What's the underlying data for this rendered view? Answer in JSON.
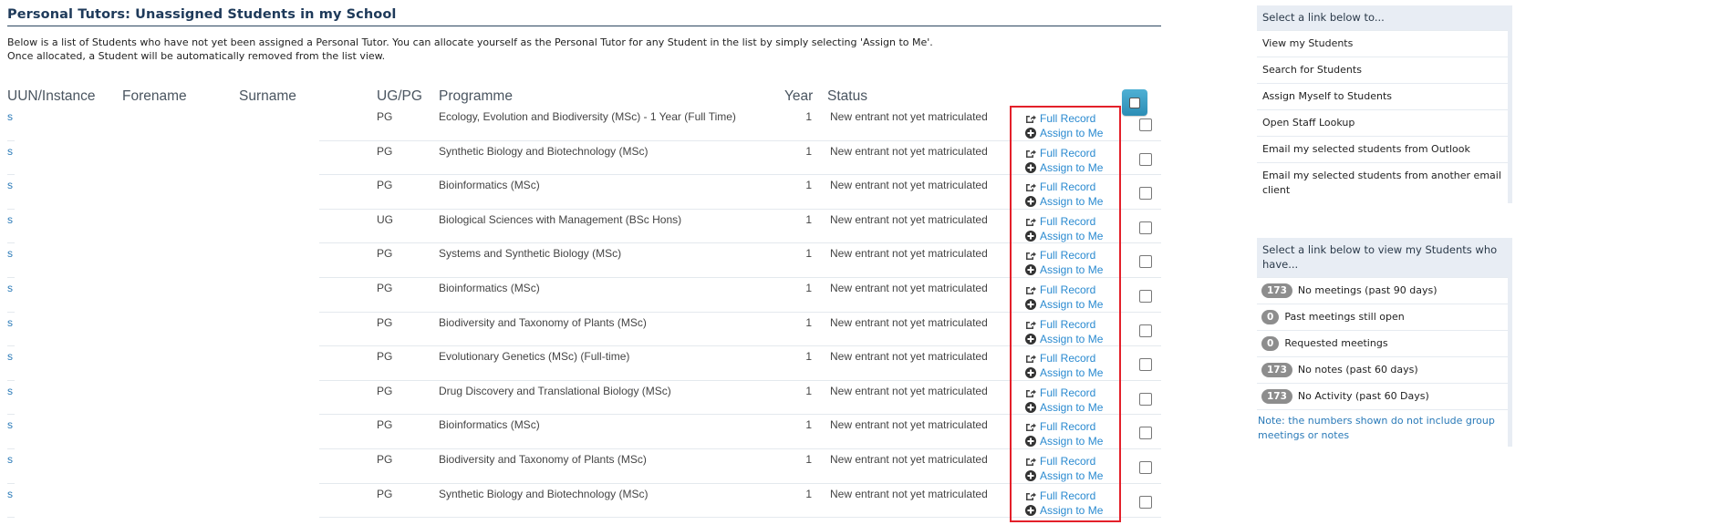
{
  "page": {
    "title": "Personal Tutors: Unassigned Students in my School",
    "intro_line1": "Below is a list of Students who have not yet been assigned a Personal Tutor. You can allocate yourself as the Personal Tutor for any Student in the list by simply selecting 'Assign to Me'.",
    "intro_line2": "Once allocated, a Student will be automatically removed from the list view."
  },
  "table": {
    "headers": {
      "uun": "UUN/Instance",
      "forename": "Forename",
      "surname": "Surname",
      "ugpg": "UG/PG",
      "programme": "Programme",
      "year": "Year",
      "status": "Status"
    },
    "actions": {
      "full_record": "Full Record",
      "assign": "Assign to Me"
    },
    "rows": [
      {
        "uun": "s",
        "ugpg": "PG",
        "programme": "Ecology, Evolution and Biodiversity (MSc) - 1 Year (Full Time)",
        "year": "1",
        "status": "New entrant not yet matriculated"
      },
      {
        "uun": "s",
        "ugpg": "PG",
        "programme": "Synthetic Biology and Biotechnology (MSc)",
        "year": "1",
        "status": "New entrant not yet matriculated"
      },
      {
        "uun": "s",
        "ugpg": "PG",
        "programme": "Bioinformatics (MSc)",
        "year": "1",
        "status": "New entrant not yet matriculated"
      },
      {
        "uun": "s",
        "ugpg": "UG",
        "programme": "Biological Sciences with Management (BSc Hons)",
        "year": "1",
        "status": "New entrant not yet matriculated"
      },
      {
        "uun": "s",
        "ugpg": "PG",
        "programme": "Systems and Synthetic Biology (MSc)",
        "year": "1",
        "status": "New entrant not yet matriculated"
      },
      {
        "uun": "s",
        "ugpg": "PG",
        "programme": "Bioinformatics (MSc)",
        "year": "1",
        "status": "New entrant not yet matriculated"
      },
      {
        "uun": "s",
        "ugpg": "PG",
        "programme": "Biodiversity and Taxonomy of Plants (MSc)",
        "year": "1",
        "status": "New entrant not yet matriculated"
      },
      {
        "uun": "s",
        "ugpg": "PG",
        "programme": "Evolutionary Genetics (MSc) (Full-time)",
        "year": "1",
        "status": "New entrant not yet matriculated"
      },
      {
        "uun": "s",
        "ugpg": "PG",
        "programme": "Drug Discovery and Translational Biology (MSc)",
        "year": "1",
        "status": "New entrant not yet matriculated"
      },
      {
        "uun": "s",
        "ugpg": "PG",
        "programme": "Bioinformatics (MSc)",
        "year": "1",
        "status": "New entrant not yet matriculated"
      },
      {
        "uun": "s",
        "ugpg": "PG",
        "programme": "Biodiversity and Taxonomy of Plants (MSc)",
        "year": "1",
        "status": "New entrant not yet matriculated"
      },
      {
        "uun": "s",
        "ugpg": "PG",
        "programme": "Synthetic Biology and Biotechnology (MSc)",
        "year": "1",
        "status": "New entrant not yet matriculated"
      }
    ]
  },
  "sidebar": {
    "links_panel": {
      "heading": "Select a link below to...",
      "items": [
        "View my Students",
        "Search for Students",
        "Assign Myself to Students",
        "Open Staff Lookup",
        "Email my selected students from Outlook",
        "Email my selected students from another email client"
      ]
    },
    "filters_panel": {
      "heading": "Select a link below to view my Students who have...",
      "items": [
        {
          "count": "173",
          "label": "No meetings (past 90 days)"
        },
        {
          "count": "0",
          "label": "Past meetings still open"
        },
        {
          "count": "0",
          "label": "Requested meetings"
        },
        {
          "count": "173",
          "label": "No notes (past 60 days)"
        },
        {
          "count": "173",
          "label": "No Activity (past 60 Days)"
        }
      ],
      "note": "Note: the numbers shown do not include group meetings or notes"
    }
  },
  "colors": {
    "link": "#2a8ad0",
    "highlight_box": "#e3202a",
    "badge": "#8d8d8d",
    "select_all_button": "#3a9ec6"
  }
}
